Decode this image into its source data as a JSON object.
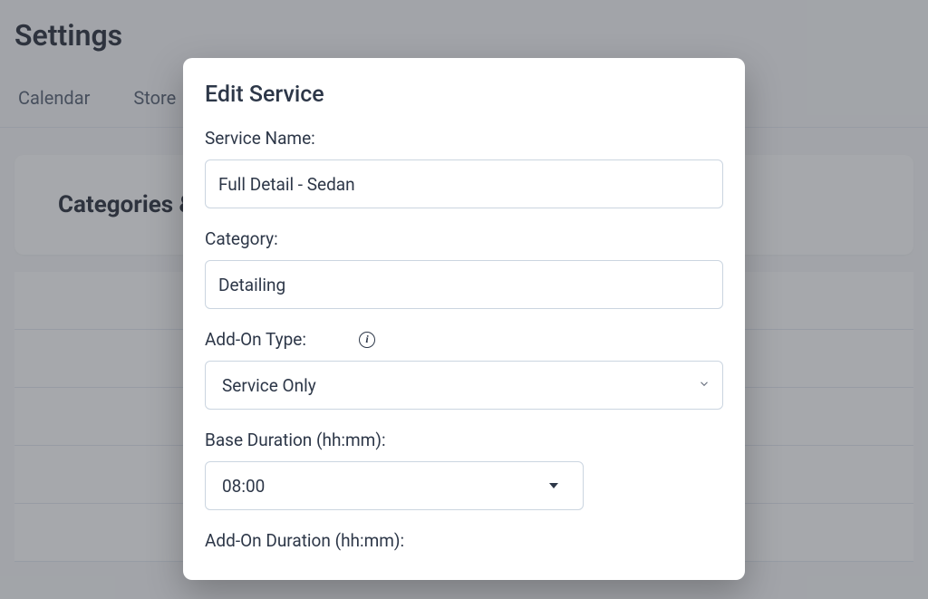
{
  "page": {
    "title": "Settings"
  },
  "tabs": {
    "calendar": "Calendar",
    "store": "Store"
  },
  "card": {
    "heading": "Categories & Services"
  },
  "dialog": {
    "title": "Edit Service",
    "serviceName": {
      "label": "Service Name:",
      "value": "Full Detail - Sedan"
    },
    "category": {
      "label": "Category:",
      "value": "Detailing"
    },
    "addOnType": {
      "label": "Add-On Type:",
      "value": "Service Only"
    },
    "baseDuration": {
      "label": "Base Duration (hh:mm):",
      "value": "08:00"
    },
    "addOnDuration": {
      "label": "Add-On Duration (hh:mm):"
    }
  }
}
